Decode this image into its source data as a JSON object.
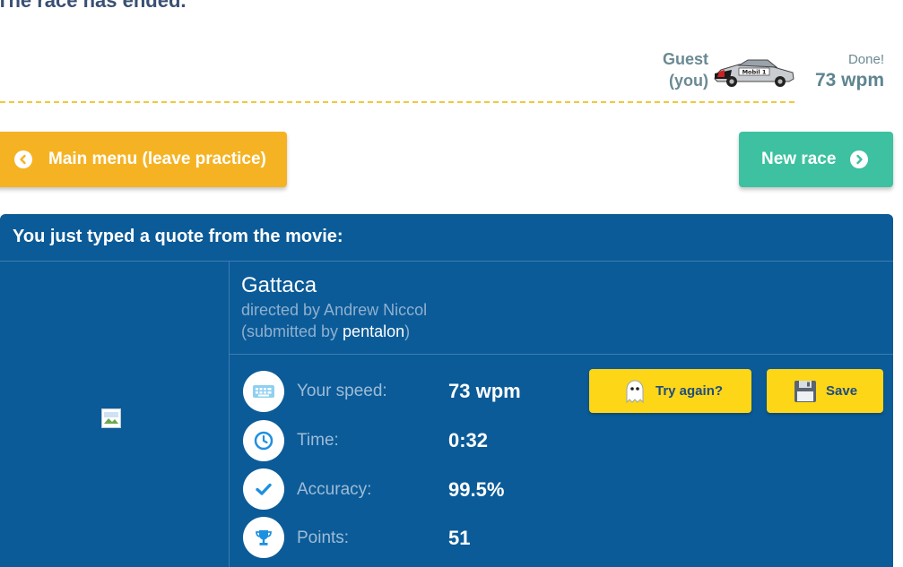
{
  "race": {
    "status_title": "The race has ended.",
    "racer_name_line1": "Guest",
    "racer_name_line2": "(you)",
    "car_label": "Mobil 1",
    "done_label": "Done!",
    "wpm": "73 wpm"
  },
  "buttons": {
    "main_menu": "Main menu (leave practice)",
    "new_race": "New race",
    "try_again": "Try again?",
    "save": "Save"
  },
  "quote": {
    "header": "You just typed a quote from the movie:",
    "title": "Gattaca",
    "directed_by": "directed by Andrew Niccol",
    "submitted_prefix": "(submitted by ",
    "submitted_user": "pentalon",
    "submitted_suffix": ")"
  },
  "stats": [
    {
      "label": "Your speed:",
      "value": "73 wpm",
      "icon": "keyboard-icon"
    },
    {
      "label": "Time:",
      "value": "0:32",
      "icon": "clock-icon"
    },
    {
      "label": "Accuracy:",
      "value": "99.5%",
      "icon": "checkmark-icon"
    },
    {
      "label": "Points:",
      "value": "51",
      "icon": "trophy-icon"
    }
  ],
  "colors": {
    "panel": "#0b5b98",
    "main_menu_button": "#f5b324",
    "new_race_button": "#3dc1a0",
    "action_buttons": "#fcd617",
    "track_line": "#f0c93a"
  }
}
